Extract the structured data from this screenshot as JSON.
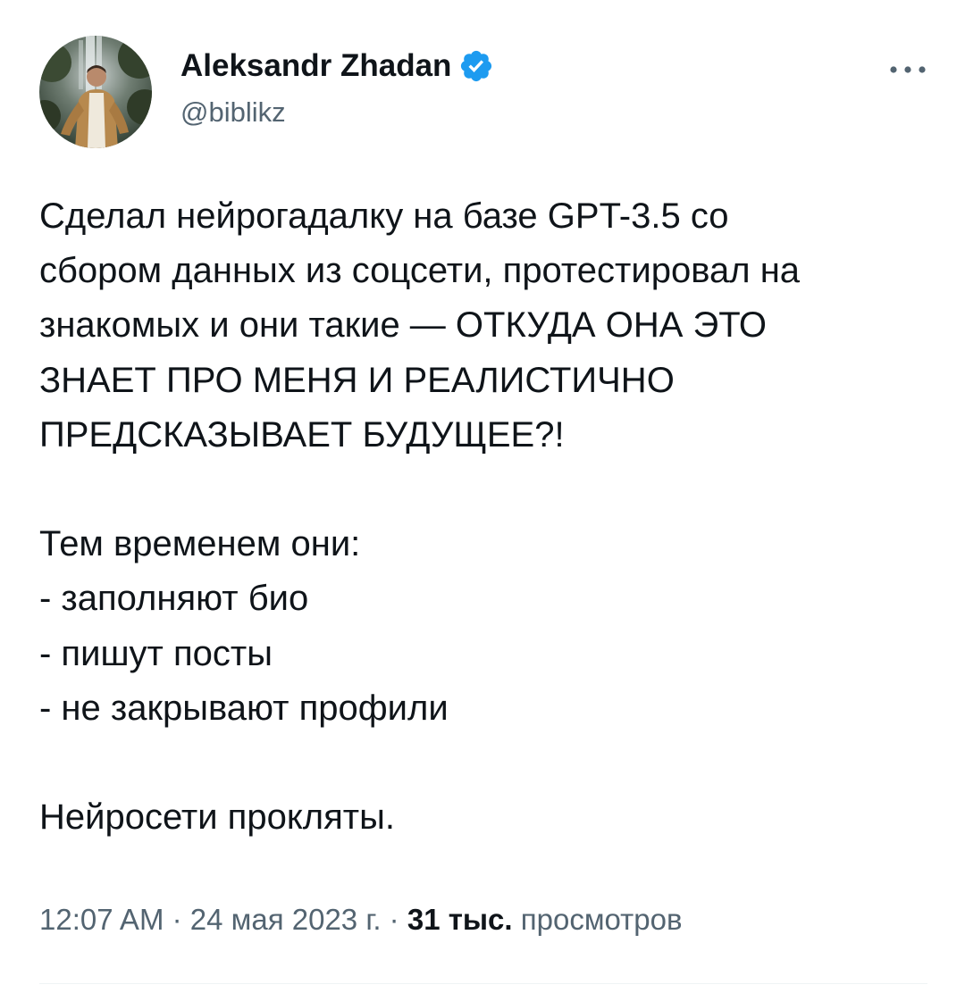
{
  "author": {
    "display_name": "Aleksandr Zhadan",
    "handle": "@biblikz",
    "verified": true,
    "avatar_icon": "profile-photo"
  },
  "tweet": {
    "lines_p1": [
      "Сделал нейрогадалку на базе GPT-3.5 со",
      "сбором данных из соцсети, протестировал на",
      "знакомых и они такие — ОТКУДА ОНА ЭТО",
      "ЗНАЕТ ПРО МЕНЯ И РЕАЛИСТИЧНО",
      "ПРЕДСКАЗЫВАЕТ БУДУЩЕЕ?!"
    ],
    "lines_p2": [
      "Тем временем они:",
      "- заполняют био",
      "- пишут посты",
      "- не закрывают профили"
    ],
    "lines_p3": [
      "Нейросети прокляты."
    ]
  },
  "meta": {
    "time": "12:07 AM",
    "separator": "·",
    "date": "24 мая 2023 г.",
    "views_count": "31 тыс.",
    "views_label": "просмотров"
  },
  "colors": {
    "verified_badge": "#1d9bf0",
    "secondary_text": "#536471",
    "primary_text": "#0f1419"
  },
  "icons": {
    "verified": "verified-badge-icon",
    "more": "more-horizontal-icon"
  }
}
